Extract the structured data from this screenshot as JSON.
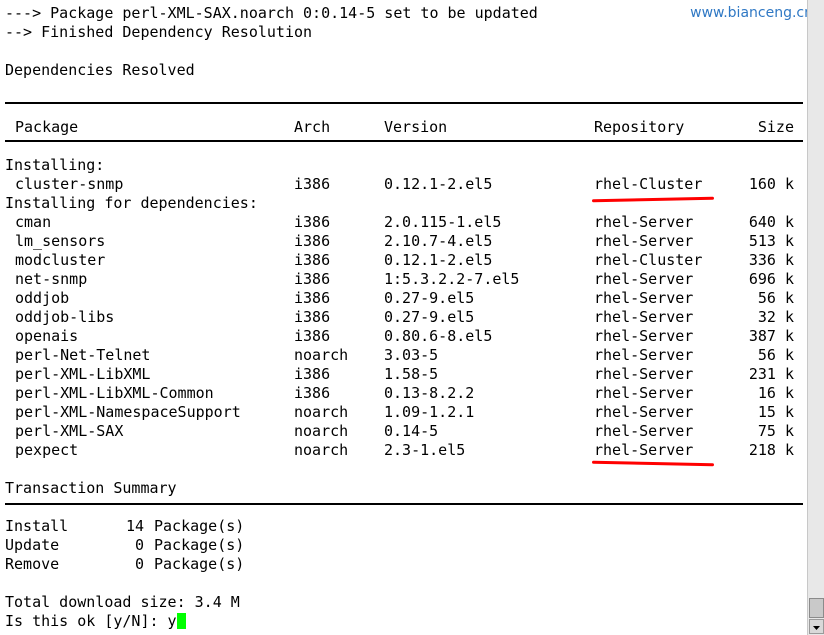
{
  "watermark": "www.bianceng.cn",
  "top_lines": [
    "---> Package perl-XML-SAX.noarch 0:0.14-5 set to be updated",
    "--> Finished Dependency Resolution",
    "Dependencies Resolved"
  ],
  "table_header": {
    "package": "Package",
    "arch": "Arch",
    "version": "Version",
    "repository": "Repository",
    "size": "Size"
  },
  "sections": {
    "installing": "Installing:",
    "installing_deps": "Installing for dependencies:"
  },
  "rows": [
    {
      "package": "cluster-snmp",
      "arch": "i386",
      "version": "0.12.1-2.el5",
      "repository": "rhel-Cluster",
      "size": "160 k"
    },
    {
      "package": "cman",
      "arch": "i386",
      "version": "2.0.115-1.el5",
      "repository": "rhel-Server",
      "size": "640 k"
    },
    {
      "package": "lm_sensors",
      "arch": "i386",
      "version": "2.10.7-4.el5",
      "repository": "rhel-Server",
      "size": "513 k"
    },
    {
      "package": "modcluster",
      "arch": "i386",
      "version": "0.12.1-2.el5",
      "repository": "rhel-Cluster",
      "size": "336 k"
    },
    {
      "package": "net-snmp",
      "arch": "i386",
      "version": "1:5.3.2.2-7.el5",
      "repository": "rhel-Server",
      "size": "696 k"
    },
    {
      "package": "oddjob",
      "arch": "i386",
      "version": "0.27-9.el5",
      "repository": "rhel-Server",
      "size": "56 k"
    },
    {
      "package": "oddjob-libs",
      "arch": "i386",
      "version": "0.27-9.el5",
      "repository": "rhel-Server",
      "size": "32 k"
    },
    {
      "package": "openais",
      "arch": "i386",
      "version": "0.80.6-8.el5",
      "repository": "rhel-Server",
      "size": "387 k"
    },
    {
      "package": "perl-Net-Telnet",
      "arch": "noarch",
      "version": "3.03-5",
      "repository": "rhel-Server",
      "size": "56 k"
    },
    {
      "package": "perl-XML-LibXML",
      "arch": "i386",
      "version": "1.58-5",
      "repository": "rhel-Server",
      "size": "231 k"
    },
    {
      "package": "perl-XML-LibXML-Common",
      "arch": "i386",
      "version": "0.13-8.2.2",
      "repository": "rhel-Server",
      "size": "16 k"
    },
    {
      "package": "perl-XML-NamespaceSupport",
      "arch": "noarch",
      "version": "1.09-1.2.1",
      "repository": "rhel-Server",
      "size": "15 k"
    },
    {
      "package": "perl-XML-SAX",
      "arch": "noarch",
      "version": "0.14-5",
      "repository": "rhel-Server",
      "size": "75 k"
    },
    {
      "package": "pexpect",
      "arch": "noarch",
      "version": "2.3-1.el5",
      "repository": "rhel-Server",
      "size": "218 k"
    }
  ],
  "summary": {
    "title": "Transaction Summary",
    "install_label": "Install",
    "install_count": "14",
    "install_unit": "Package(s)",
    "update_label": "Update",
    "update_count": "0",
    "update_unit": "Package(s)",
    "remove_label": "Remove",
    "remove_count": "0",
    "remove_unit": "Package(s)"
  },
  "total_download": "Total download size: 3.4 M",
  "prompt": "Is this ok [y/N]: y",
  "colors": {
    "annotation": "#ff0000",
    "cursor": "#00ff00",
    "watermark": "#2f78c4"
  }
}
